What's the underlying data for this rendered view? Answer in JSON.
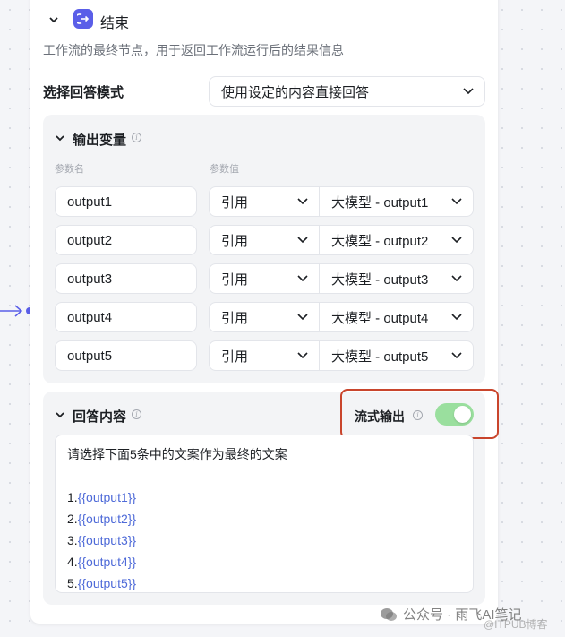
{
  "node": {
    "title": "结束",
    "description": "工作流的最终节点，用于返回工作流运行后的结果信息",
    "icon": "exit-node-icon",
    "accent_color": "#5a5ee8"
  },
  "answer_mode": {
    "label": "选择回答模式",
    "selected": "使用设定的内容直接回答"
  },
  "output_variables": {
    "title": "输出变量",
    "col_name": "参数名",
    "col_value": "参数值",
    "rows": [
      {
        "name": "output1",
        "type": "引用",
        "value": "大模型 - output1"
      },
      {
        "name": "output2",
        "type": "引用",
        "value": "大模型 - output2"
      },
      {
        "name": "output3",
        "type": "引用",
        "value": "大模型 - output3"
      },
      {
        "name": "output4",
        "type": "引用",
        "value": "大模型 - output4"
      },
      {
        "name": "output5",
        "type": "引用",
        "value": "大模型 - output5"
      }
    ]
  },
  "answer_content": {
    "title": "回答内容",
    "stream_label": "流式输出",
    "stream_enabled": true,
    "stream_color": "#9adf9e",
    "highlight_color": "#c9452c",
    "intro": "请选择下面5条中的文案作为最终的文案",
    "items": [
      {
        "prefix": "1.",
        "ref": "{{output1}}"
      },
      {
        "prefix": "2.",
        "ref": "{{output2}}"
      },
      {
        "prefix": "3.",
        "ref": "{{output3}}"
      },
      {
        "prefix": "4.",
        "ref": "{{output4}}"
      },
      {
        "prefix": "5.",
        "ref": "{{output5}}"
      }
    ]
  },
  "watermark": {
    "main": "公众号 · 雨飞AI笔记",
    "sub": "@ITPUB博客"
  }
}
